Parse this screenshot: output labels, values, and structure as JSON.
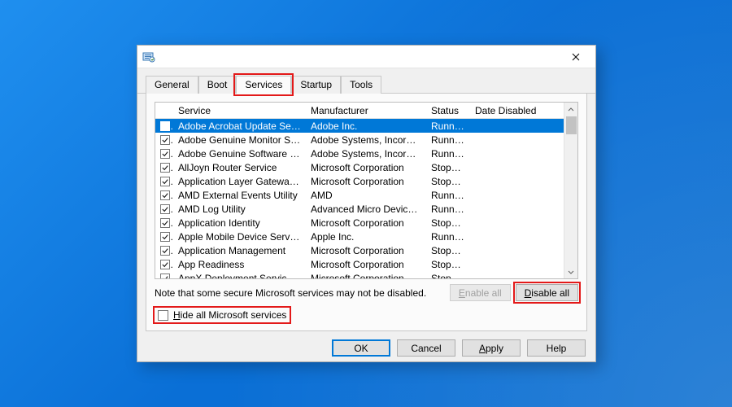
{
  "tabs": {
    "general": "General",
    "boot": "Boot",
    "services": "Services",
    "startup": "Startup",
    "tools": "Tools"
  },
  "columns": {
    "service": "Service",
    "manufacturer": "Manufacturer",
    "status": "Status",
    "date_disabled": "Date Disabled"
  },
  "rows": [
    {
      "name": "Adobe Acrobat Update Service",
      "mfr": "Adobe Inc.",
      "status": "Running",
      "selected": true
    },
    {
      "name": "Adobe Genuine Monitor Service",
      "mfr": "Adobe Systems, Incorpora...",
      "status": "Running"
    },
    {
      "name": "Adobe Genuine Software Integri...",
      "mfr": "Adobe Systems, Incorpora...",
      "status": "Running"
    },
    {
      "name": "AllJoyn Router Service",
      "mfr": "Microsoft Corporation",
      "status": "Stopped"
    },
    {
      "name": "Application Layer Gateway Service",
      "mfr": "Microsoft Corporation",
      "status": "Stopped"
    },
    {
      "name": "AMD External Events Utility",
      "mfr": "AMD",
      "status": "Running"
    },
    {
      "name": "AMD Log Utility",
      "mfr": "Advanced Micro Devices, I...",
      "status": "Running"
    },
    {
      "name": "Application Identity",
      "mfr": "Microsoft Corporation",
      "status": "Stopped"
    },
    {
      "name": "Apple Mobile Device Service",
      "mfr": "Apple Inc.",
      "status": "Running"
    },
    {
      "name": "Application Management",
      "mfr": "Microsoft Corporation",
      "status": "Stopped"
    },
    {
      "name": "App Readiness",
      "mfr": "Microsoft Corporation",
      "status": "Stopped"
    },
    {
      "name": "AppX Deployment Service (AppX...",
      "mfr": "Microsoft Corporation",
      "status": "Stopped"
    }
  ],
  "note": "Note that some secure Microsoft services may not be disabled.",
  "buttons": {
    "enable_all": "Enable all",
    "disable_all": "Disable all",
    "ok": "OK",
    "cancel": "Cancel",
    "apply": "Apply",
    "help": "Help"
  },
  "hide_checkbox_label": "Hide all Microsoft services"
}
